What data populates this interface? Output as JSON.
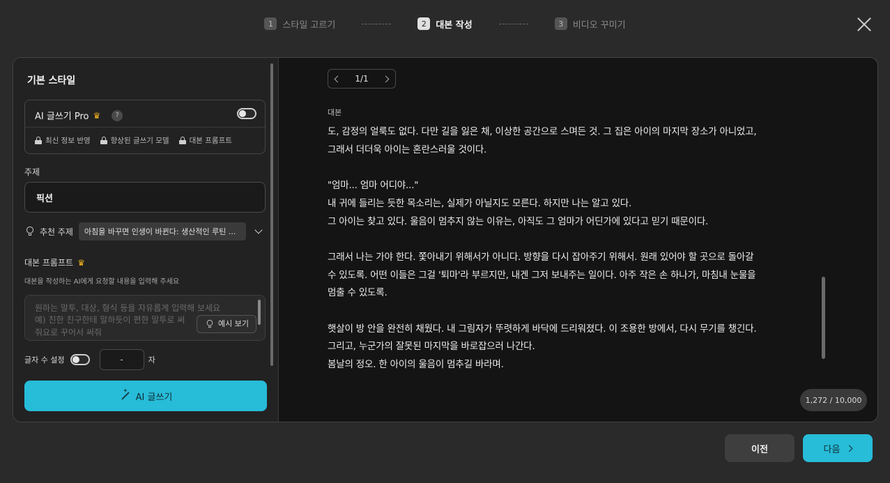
{
  "stepper": {
    "steps": [
      {
        "num": "1",
        "label": "스타일 고르기"
      },
      {
        "num": "2",
        "label": "대본 작성"
      },
      {
        "num": "3",
        "label": "비디오 꾸미기"
      }
    ],
    "active_step": 2
  },
  "left": {
    "section_title": "기본 스타일",
    "pro": {
      "title": "AI 글쓰기 Pro",
      "help_glyph": "?",
      "toggle_on": false,
      "features": [
        "최신 정보 반영",
        "향상된 글쓰기 모델",
        "대본 프롬프트"
      ]
    },
    "topic": {
      "label": "주제",
      "value": "픽션"
    },
    "recommend": {
      "label": "추천 주제",
      "value": "아침을 바꾸면 인생이 바뀐다: 생산적인 루틴 ..."
    },
    "prompt": {
      "label": "대본 프롬프트",
      "help": "대본을 작성하는 AI에게 요청할 내용을 입력해 주세요",
      "placeholder": "원하는 말투, 대상, 형식 등을 자유롭게 입력해 보세요\n예) 친한 친구한테 말하듯이 편한 말투로 써\n줘요로 꾸어서 써줘",
      "example_label": "예시 보기"
    },
    "length": {
      "label": "글자 수 설정",
      "toggle_on": false,
      "value": "-",
      "unit": "자"
    },
    "ai_button": "AI 글쓰기"
  },
  "right": {
    "pager": "1/1",
    "script_label": "대본",
    "script": "도, 감정의 얼룩도 없다. 다만 길을 잃은 채, 이상한 공간으로 스며든 것. 그 집은 아이의 마지막 장소가 아니었고,\n그래서 더더욱 아이는 혼란스러울 것이다.\n\n\"엄마... 엄마 어디야...\"\n내 귀에 들리는 듯한 목소리는, 실제가 아닐지도 모른다. 하지만 나는 알고 있다.\n그 아이는 찾고 있다. 울음이 멈추지 않는 이유는, 아직도 그 엄마가 어딘가에 있다고 믿기 때문이다.\n\n그래서 나는 가야 한다. 쫓아내기 위해서가 아니다. 방향을 다시 잡아주기 위해서. 원래 있어야 할 곳으로 돌아갈\n수 있도록. 어떤 이들은 그걸 '퇴마'라 부르지만, 내겐 그저 보내주는 일이다. 아주 작은 손 하나가, 마침내 눈물을\n멈출 수 있도록.\n\n햇살이 방 안을 완전히 채웠다. 내 그림자가 뚜렷하게 바닥에 드리워졌다. 이 조용한 방에서, 다시 무기를 챙긴다.\n그리고, 누군가의 잘못된 마지막을 바로잡으러 나간다.\n봄날의 정오. 한 아이의 울음이 멈추길 바라며.",
    "counter": "1,272 / 10,000"
  },
  "footer": {
    "prev_label": "이전",
    "next_label": "다음"
  },
  "colors": {
    "accent": "#27bcd8",
    "crown": "#f3b320",
    "background": "#2a2a2a",
    "panel": "#141414"
  }
}
